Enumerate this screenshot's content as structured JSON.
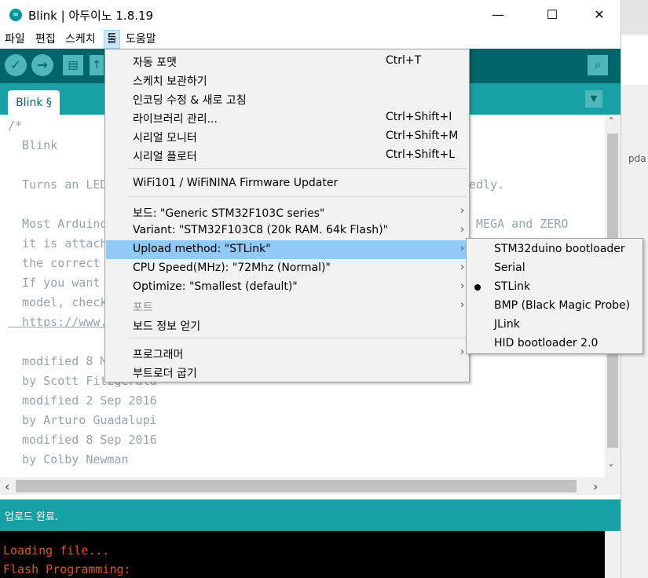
{
  "window": {
    "title": "Blink | 아두이노 1.8.19",
    "app_icon_glyph": "∞",
    "minimize_glyph": "—",
    "maximize_glyph": "☐",
    "close_glyph": "✕"
  },
  "menubar": {
    "items": [
      {
        "label": "파일"
      },
      {
        "label": "편집"
      },
      {
        "label": "스케치"
      },
      {
        "label": "툴"
      },
      {
        "label": "도움말"
      }
    ]
  },
  "toolbar": {
    "verify_icon": "checkmark-icon",
    "upload_icon": "arrow-right-icon",
    "new_icon": "document-icon",
    "open_icon": "arrow-up-icon",
    "save_icon": "arrow-down-icon",
    "serial_icon": "magnifier-icon",
    "verify_glyph": "✓",
    "upload_glyph": "→",
    "new_glyph": "▤",
    "open_glyph": "↑",
    "serial_glyph": "⌕"
  },
  "tabs": {
    "active": "Blink §",
    "menu_glyph": "▼"
  },
  "editor": {
    "lines": [
      "/*",
      "  Blink",
      "",
      "  Turns an LED on for one second, then off for one second, repeatedly.",
      "",
      "  Most Arduinos have an on-board LED you can control. On the UNO, MEGA and ZERO",
      "  it is attached to digital pin 13, on MKR1000 on pin 6. LED_BUILTIN is set to",
      "  the correct LED pin independent of which board is used.",
      "  If you want to know what pin the on-board LED is connected to on your Arduino",
      "  model, check the Technical Specs of your board at:",
      "  https://www.arduino.cc/en/Main/Products",
      "",
      "  modified 8 May 2014",
      "  by Scott Fitzgerald",
      "  modified 2 Sep 2016",
      "  by Arturo Guadalupi",
      "  modified 8 Sep 2016",
      "  by Colby Newman"
    ]
  },
  "status": {
    "text": "업로드 완료."
  },
  "console": {
    "lines": [
      "Loading file...",
      "Flash Programming:"
    ]
  },
  "right_strip": {
    "text": "pda"
  },
  "tools_menu": {
    "items": [
      {
        "label": "자동 포맷",
        "shortcut": "Ctrl+T"
      },
      {
        "label": "스케치 보관하기",
        "shortcut": ""
      },
      {
        "label": "인코딩 수정 & 새로 고침",
        "shortcut": ""
      },
      {
        "label": "라이브러리 관리...",
        "shortcut": "Ctrl+Shift+I"
      },
      {
        "label": "시리얼 모니터",
        "shortcut": "Ctrl+Shift+M"
      },
      {
        "label": "시리얼 플로터",
        "shortcut": "Ctrl+Shift+L"
      },
      {
        "label": "WiFi101 / WiFiNINA Firmware Updater",
        "shortcut": ""
      },
      {
        "label": "보드: \"Generic STM32F103C series\"",
        "shortcut": ""
      },
      {
        "label": "Variant: \"STM32F103C8 (20k RAM. 64k Flash)\"",
        "shortcut": ""
      },
      {
        "label": "Upload method: \"STLink\"",
        "shortcut": ""
      },
      {
        "label": "CPU Speed(MHz): \"72Mhz (Normal)\"",
        "shortcut": ""
      },
      {
        "label": "Optimize: \"Smallest (default)\"",
        "shortcut": ""
      },
      {
        "label": "포트",
        "shortcut": ""
      },
      {
        "label": "보드 정보 얻기",
        "shortcut": ""
      },
      {
        "label": "프로그래머",
        "shortcut": ""
      },
      {
        "label": "부트로더 굽기",
        "shortcut": ""
      }
    ],
    "submenu_arrow_glyph": "›"
  },
  "upload_method_submenu": {
    "items": [
      {
        "label": "STM32duino bootloader"
      },
      {
        "label": "Serial"
      },
      {
        "label": "STLink"
      },
      {
        "label": "BMP (Black Magic Probe)"
      },
      {
        "label": "JLink"
      },
      {
        "label": "HID bootloader 2.0"
      }
    ],
    "selected": "STLink"
  },
  "scroll": {
    "left_glyph": "‹",
    "right_glyph": "›",
    "up_glyph": "˄",
    "down_glyph": "˅"
  }
}
